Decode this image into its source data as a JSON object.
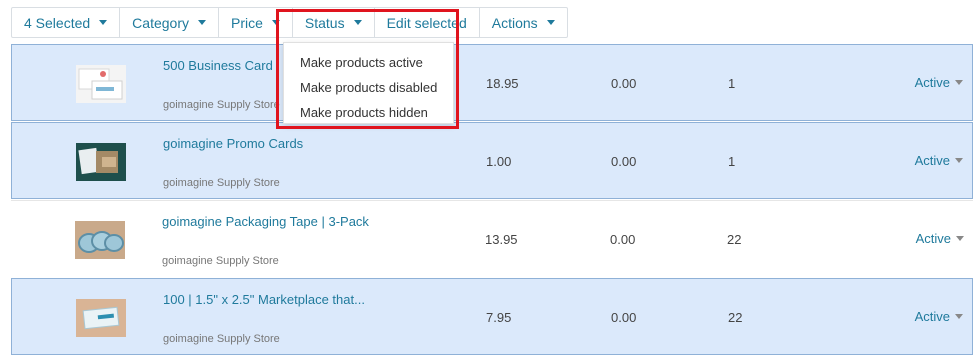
{
  "toolbar": {
    "selected_label": "4 Selected",
    "category_label": "Category",
    "price_label": "Price",
    "status_label": "Status",
    "edit_selected_label": "Edit selected",
    "actions_label": "Actions"
  },
  "status_menu": {
    "items": [
      "Make products active",
      "Make products disabled",
      "Make products hidden"
    ]
  },
  "products": [
    {
      "name": "500 Business Card",
      "store": "goimagine Supply Store",
      "price": "18.95",
      "list_price": "0.00",
      "quantity": "1",
      "status": "Active",
      "selected": true
    },
    {
      "name": "goimagine Promo Cards",
      "store": "goimagine Supply Store",
      "price": "1.00",
      "list_price": "0.00",
      "quantity": "1",
      "status": "Active",
      "selected": true
    },
    {
      "name": "goimagine Packaging Tape | 3-Pack",
      "store": "goimagine Supply Store",
      "price": "13.95",
      "list_price": "0.00",
      "quantity": "22",
      "status": "Active",
      "selected": false
    },
    {
      "name": "100 | 1.5\" x 2.5\" Marketplace that...",
      "store": "goimagine Supply Store",
      "price": "7.95",
      "list_price": "0.00",
      "quantity": "22",
      "status": "Active",
      "selected": true
    }
  ],
  "colors": {
    "accent": "#1f7a9c",
    "selected_row": "#dbe9fb",
    "highlight": "#e0141e"
  }
}
